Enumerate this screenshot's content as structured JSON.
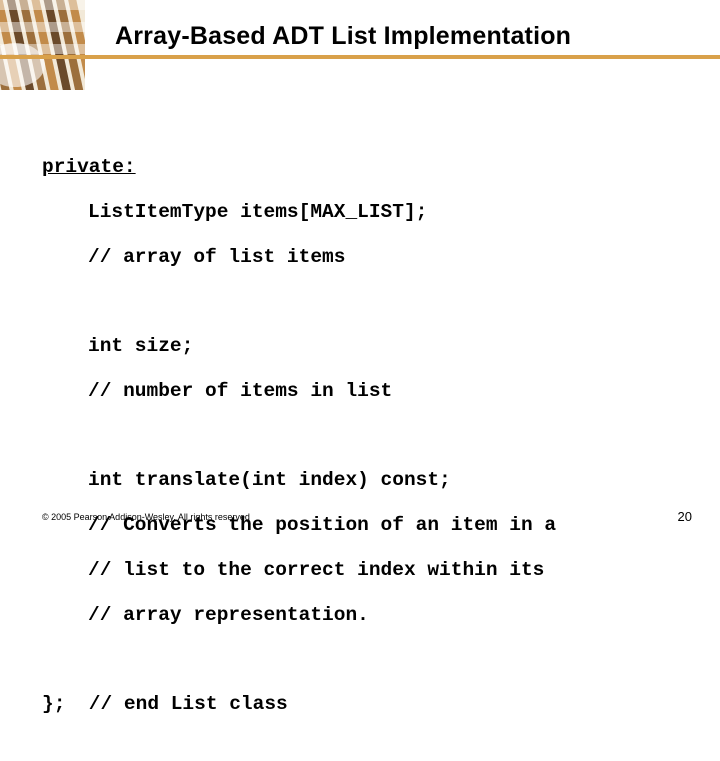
{
  "title": "Array-Based ADT List Implementation",
  "code": {
    "l1": "private:",
    "l2": "ListItemType items[MAX_LIST];",
    "l3": "// array of list items",
    "l4": "int size;",
    "l5": "// number of items in list",
    "l6": "int translate(int index) const;",
    "l7": "// Converts the position of an item in a",
    "l8": "// list to the correct index within its",
    "l9": "// array representation.",
    "l10": "};  // end List class"
  },
  "footer": {
    "copyright": "© 2005 Pearson Addison-Wesley. All rights reserved",
    "page": "20"
  },
  "colors": {
    "accent": "#d9a14a"
  }
}
